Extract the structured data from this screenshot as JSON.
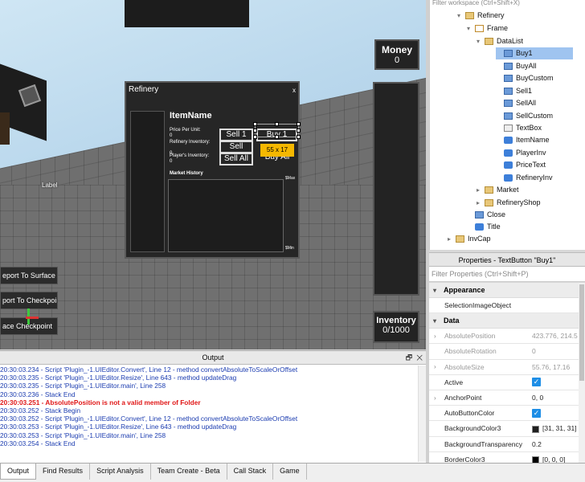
{
  "viewport": {
    "world_label": "Label",
    "teleport_buttons": [
      "eport To Surface",
      "port To Checkpoint",
      "ace Checkpoint"
    ],
    "money": {
      "title": "Money",
      "value": "0"
    },
    "inventory": {
      "title": "Inventory",
      "value": "0/1000"
    },
    "refinery": {
      "title": "Refinery",
      "close": "x",
      "item_name": "ItemName",
      "price_per_unit_label": "Price Per Unit:",
      "price_per_unit_value": "0",
      "refinery_inventory_label": "Refinery Inventory:",
      "refinery_inventory_value": "0",
      "player_inventory_label": "Player's Inventory:",
      "player_inventory_value": "0",
      "buttons": {
        "sell1": "Sell 1",
        "buy1": "Buy 1",
        "sell": "Sell",
        "sellall": "Sell All",
        "buyall": "Buy All"
      },
      "size_tooltip": "55 x 17",
      "market_history": "Market History",
      "max_label": "$Max",
      "min_label": "$Min"
    }
  },
  "explorer": {
    "filter_placeholder": "Filter workspace (Ctrl+Shift+X)",
    "items": [
      {
        "label": "Refinery",
        "icon": "folder-icon",
        "arrow": "▾",
        "selected": false
      },
      {
        "label": "Frame",
        "icon": "frame-icon",
        "arrow": "▾",
        "selected": false
      },
      {
        "label": "DataList",
        "icon": "folder-icon",
        "arrow": "▾",
        "selected": false
      },
      {
        "label": "Buy1",
        "icon": "textbutton-icon",
        "arrow": "",
        "selected": true
      },
      {
        "label": "BuyAll",
        "icon": "textbutton-icon",
        "arrow": "",
        "selected": false
      },
      {
        "label": "BuyCustom",
        "icon": "textbutton-icon",
        "arrow": "",
        "selected": false
      },
      {
        "label": "Sell1",
        "icon": "textbutton-icon",
        "arrow": "",
        "selected": false
      },
      {
        "label": "SellAll",
        "icon": "textbutton-icon",
        "arrow": "",
        "selected": false
      },
      {
        "label": "SellCustom",
        "icon": "textbutton-icon",
        "arrow": "",
        "selected": false
      },
      {
        "label": "TextBox",
        "icon": "textbox-icon",
        "arrow": "",
        "selected": false
      },
      {
        "label": "ItemName",
        "icon": "script-icon",
        "arrow": "",
        "selected": false
      },
      {
        "label": "PlayerInv",
        "icon": "script-icon",
        "arrow": "",
        "selected": false
      },
      {
        "label": "PriceText",
        "icon": "script-icon",
        "arrow": "",
        "selected": false
      },
      {
        "label": "RefineryInv",
        "icon": "script-icon",
        "arrow": "",
        "selected": false
      },
      {
        "label": "Market",
        "icon": "folder-icon",
        "arrow": "▸",
        "selected": false
      },
      {
        "label": "RefineryShop",
        "icon": "folder-icon",
        "arrow": "▸",
        "selected": false
      },
      {
        "label": "Close",
        "icon": "textbutton-icon",
        "arrow": "",
        "selected": false
      },
      {
        "label": "Title",
        "icon": "script-icon",
        "arrow": "",
        "selected": false
      },
      {
        "label": "InvCap",
        "icon": "folder-icon",
        "arrow": "▸",
        "selected": false
      }
    ]
  },
  "properties": {
    "header": "Properties - TextButton \"Buy1\"",
    "filter_placeholder": "Filter Properties (Ctrl+Shift+P)",
    "sections": {
      "appearance": "Appearance",
      "data": "Data"
    },
    "appearance_rows": [
      {
        "name": "SelectionImageObject",
        "value": ""
      }
    ],
    "data_rows": [
      {
        "name": "AbsolutePosition",
        "value": "423.776, 214.5",
        "dim": true,
        "expand": true
      },
      {
        "name": "AbsoluteRotation",
        "value": "0",
        "dim": true,
        "expand": false
      },
      {
        "name": "AbsoluteSize",
        "value": "55.76, 17.16",
        "dim": true,
        "expand": true
      },
      {
        "name": "Active",
        "value": "check",
        "dim": false,
        "expand": false
      },
      {
        "name": "AnchorPoint",
        "value": "0, 0",
        "dim": false,
        "expand": true
      },
      {
        "name": "AutoButtonColor",
        "value": "check",
        "dim": false,
        "expand": false
      },
      {
        "name": "BackgroundColor3",
        "value": "[31, 31, 31]",
        "swatch": "#1f1f1f",
        "dim": false,
        "expand": false
      },
      {
        "name": "BackgroundTransparency",
        "value": "0.2",
        "dim": false,
        "expand": false
      },
      {
        "name": "BorderColor3",
        "value": "[0, 0, 0]",
        "swatch": "#000000",
        "dim": false,
        "expand": false
      },
      {
        "name": "BorderSizePixel",
        "value": "2",
        "dim": false,
        "expand": false
      }
    ]
  },
  "output": {
    "title": "Output",
    "lines": [
      {
        "text": "20:30:03.234 - Script 'Plugin_-1.UIEditor.Convert', Line 12 - method convertAbsoluteToScaleOrOffset",
        "error": false
      },
      {
        "text": "20:30:03.235 - Script 'Plugin_-1.UIEditor.Resize', Line 643 - method updateDrag",
        "error": false
      },
      {
        "text": "20:30:03.235 - Script 'Plugin_-1.UIEditor.main', Line 258",
        "error": false
      },
      {
        "text": "20:30:03.236 - Stack End",
        "error": false
      },
      {
        "text": "20:30:03.251 - AbsolutePosition is not a valid member of Folder",
        "error": true
      },
      {
        "text": "20:30:03.252 - Stack Begin",
        "error": false
      },
      {
        "text": "20:30:03.252 - Script 'Plugin_-1.UIEditor.Convert', Line 12 - method convertAbsoluteToScaleOrOffset",
        "error": false
      },
      {
        "text": "20:30:03.253 - Script 'Plugin_-1.UIEditor.Resize', Line 643 - method updateDrag",
        "error": false
      },
      {
        "text": "20:30:03.253 - Script 'Plugin_-1.UIEditor.main', Line 258",
        "error": false
      },
      {
        "text": "20:30:03.254 - Stack End",
        "error": false
      }
    ]
  },
  "tabs": [
    "Output",
    "Find Results",
    "Script Analysis",
    "Team Create - Beta",
    "Call Stack",
    "Game"
  ]
}
